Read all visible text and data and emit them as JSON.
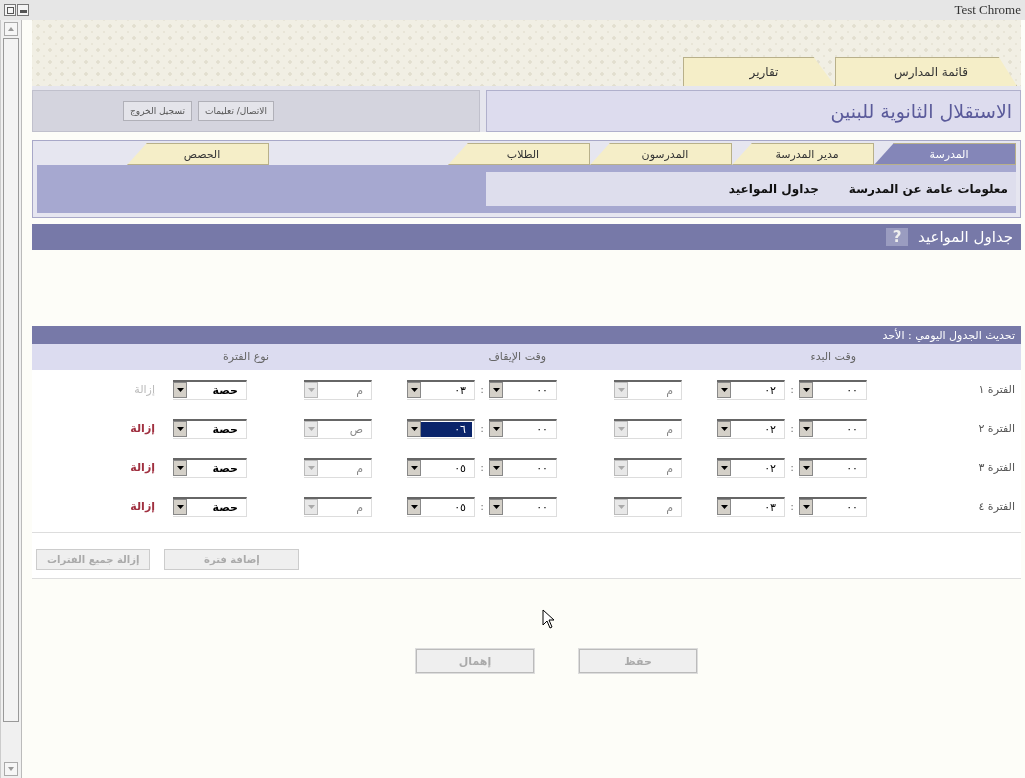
{
  "window": {
    "title": "Test Chrome"
  },
  "top_tabs": [
    {
      "label": "قائمة المدارس",
      "selected": false
    },
    {
      "label": "تقارير",
      "selected": false
    }
  ],
  "school_name": "الاستقلال الثانوية للبنين",
  "header_buttons": [
    "الاتصال/ تعليمات",
    "تسجيل الخروج"
  ],
  "nav_tabs": [
    {
      "label": "المدرسة",
      "selected": true
    },
    {
      "label": "مدير المدرسة",
      "selected": false
    },
    {
      "label": "المدرسون",
      "selected": false
    },
    {
      "label": "الطلاب",
      "selected": false
    }
  ],
  "side_tabs": [
    {
      "label": "الحصص",
      "selected": false
    }
  ],
  "subnav_links": [
    "معلومات عامة عن المدرسة",
    "جداول المواعيد"
  ],
  "page_title": "جداول المواعيد",
  "help_label": "?",
  "schedule": {
    "title": "تحديث الجدول اليومي : الأحد",
    "columns": [
      "وقت البدء",
      "وقت الإيقاف",
      "نوع الفترة"
    ],
    "rows": [
      {
        "label": "الفترة ١",
        "start": {
          "fields": [
            {
              "value": "٠٠",
              "focused": false
            },
            {
              "value": "٠٢",
              "focused": false
            }
          ],
          "period": {
            "value": "م",
            "disabled": true
          }
        },
        "stop": {
          "fields": [
            {
              "value": "٠٠",
              "focused": false
            },
            {
              "value": "٠٣",
              "focused": false
            }
          ],
          "period": {
            "value": "م",
            "disabled": true
          }
        },
        "type": "حصة",
        "remove": {
          "label": "إزالة",
          "disabled": true
        }
      },
      {
        "label": "الفترة ٢",
        "start": {
          "fields": [
            {
              "value": "٠٠",
              "focused": false
            },
            {
              "value": "٠٢",
              "focused": false
            }
          ],
          "period": {
            "value": "م",
            "disabled": true
          }
        },
        "stop": {
          "fields": [
            {
              "value": "٠٠",
              "focused": false
            },
            {
              "value": "٠٦",
              "focused": true
            }
          ],
          "period": {
            "value": "ص",
            "disabled": true
          }
        },
        "type": "حصة",
        "remove": {
          "label": "إزالة",
          "disabled": false
        }
      },
      {
        "label": "الفترة ٣",
        "start": {
          "fields": [
            {
              "value": "٠٠",
              "focused": false
            },
            {
              "value": "٠٢",
              "focused": false
            }
          ],
          "period": {
            "value": "م",
            "disabled": true
          }
        },
        "stop": {
          "fields": [
            {
              "value": "٠٠",
              "focused": false
            },
            {
              "value": "٠٥",
              "focused": false
            }
          ],
          "period": {
            "value": "م",
            "disabled": true
          }
        },
        "type": "حصة",
        "remove": {
          "label": "إزالة",
          "disabled": false
        }
      },
      {
        "label": "الفترة ٤",
        "start": {
          "fields": [
            {
              "value": "٠٠",
              "focused": false
            },
            {
              "value": "٠٣",
              "focused": false
            }
          ],
          "period": {
            "value": "م",
            "disabled": true
          }
        },
        "stop": {
          "fields": [
            {
              "value": "٠٠",
              "focused": false
            },
            {
              "value": "٠٥",
              "focused": false
            }
          ],
          "period": {
            "value": "م",
            "disabled": true
          }
        },
        "type": "حصة",
        "remove": {
          "label": "إزالة",
          "disabled": false
        }
      }
    ],
    "time_separator": ":",
    "actions": [
      {
        "label": "إضافة فترة",
        "disabled": true
      },
      {
        "label": "إزالة جميع الفترات",
        "disabled": true
      }
    ]
  },
  "form_buttons": [
    {
      "label": "حفظ",
      "disabled": true
    },
    {
      "label": "إهمال",
      "disabled": true
    }
  ]
}
